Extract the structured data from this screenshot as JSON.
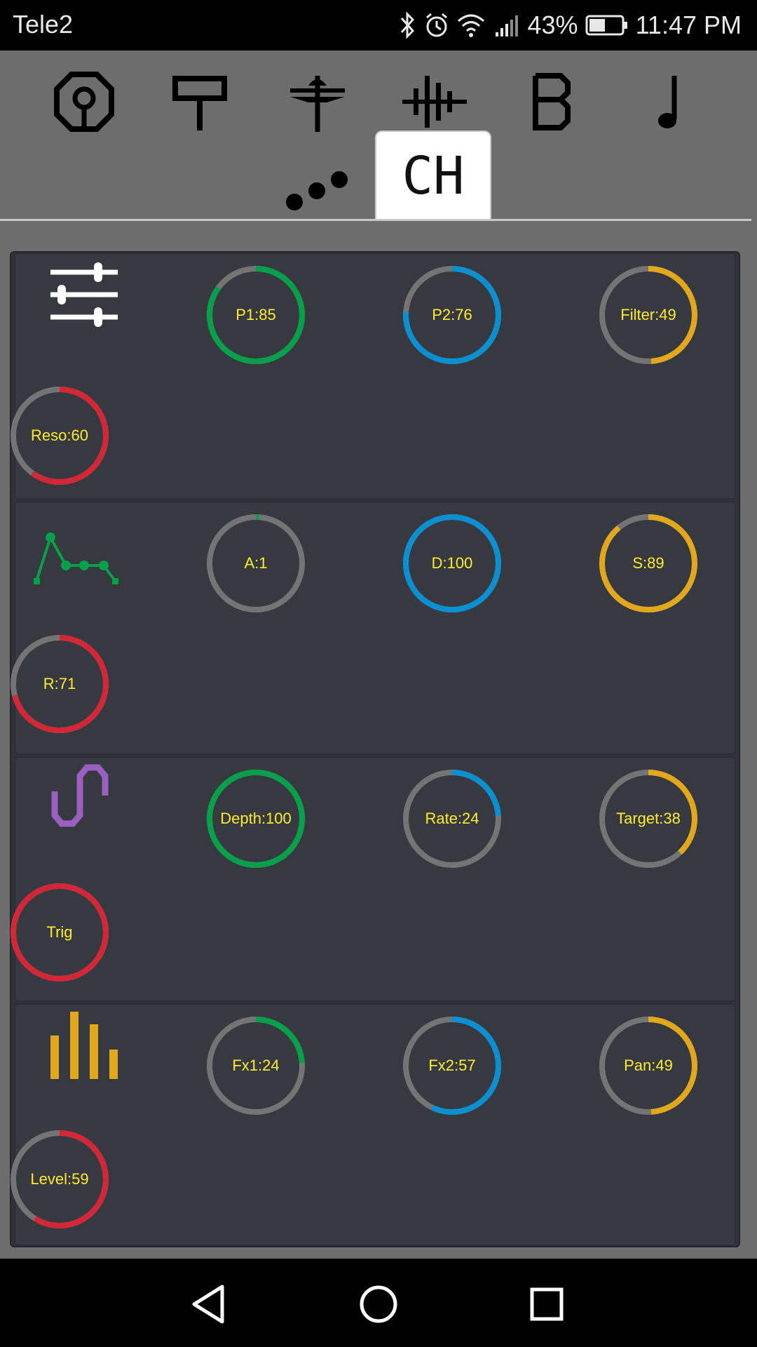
{
  "status_bar": {
    "carrier": "Tele2",
    "battery": "43%",
    "time": "11:47 PM",
    "icons": [
      "bluetooth-icon",
      "alarm-icon",
      "wifi-icon",
      "signal-icon",
      "battery-icon"
    ]
  },
  "instrument_nav": {
    "icons": [
      "bass-drum-icon",
      "snare-drum-icon",
      "cymbal-icon",
      "clap-icon",
      "bass-icon",
      "note-icon"
    ]
  },
  "tabs": {
    "more_icon": "more-dots-icon",
    "active_tab_label": "CH"
  },
  "colors": {
    "green": "#07a04a",
    "blue": "#0a8fd1",
    "yellow": "#e3a71d",
    "red": "#d32738",
    "track": "#747474",
    "label": "#ffeb2e",
    "panel": "#30343a",
    "background": "#6d6d6d"
  },
  "sections": [
    {
      "name": "filter",
      "icon": "sliders-icon",
      "knobs": [
        {
          "label": "P1:85",
          "value": 85,
          "color": "green"
        },
        {
          "label": "P2:76",
          "value": 76,
          "color": "blue"
        },
        {
          "label": "Filter:49",
          "value": 49,
          "color": "yellow"
        },
        {
          "label": "Reso:60",
          "value": 60,
          "color": "red"
        }
      ]
    },
    {
      "name": "envelope",
      "icon": "envelope-icon",
      "knobs": [
        {
          "label": "A:1",
          "value": 1,
          "color": "green"
        },
        {
          "label": "D:100",
          "value": 100,
          "color": "blue"
        },
        {
          "label": "S:89",
          "value": 89,
          "color": "yellow"
        },
        {
          "label": "R:71",
          "value": 71,
          "color": "red"
        }
      ]
    },
    {
      "name": "lfo",
      "icon": "lfo-wave-icon",
      "knobs": [
        {
          "label": "Depth:100",
          "value": 100,
          "color": "green"
        },
        {
          "label": "Rate:24",
          "value": 24,
          "color": "blue"
        },
        {
          "label": "Target:38",
          "value": 38,
          "color": "yellow"
        },
        {
          "label": "Trig",
          "value": 100,
          "color": "red"
        }
      ]
    },
    {
      "name": "mixer",
      "icon": "level-bars-icon",
      "knobs": [
        {
          "label": "Fx1:24",
          "value": 24,
          "color": "green"
        },
        {
          "label": "Fx2:57",
          "value": 57,
          "color": "blue"
        },
        {
          "label": "Pan:49",
          "value": 49,
          "color": "yellow"
        },
        {
          "label": "Level:59",
          "value": 59,
          "color": "red"
        }
      ]
    }
  ],
  "system_nav": {
    "icons": [
      "back-icon",
      "home-icon",
      "recents-icon"
    ]
  }
}
